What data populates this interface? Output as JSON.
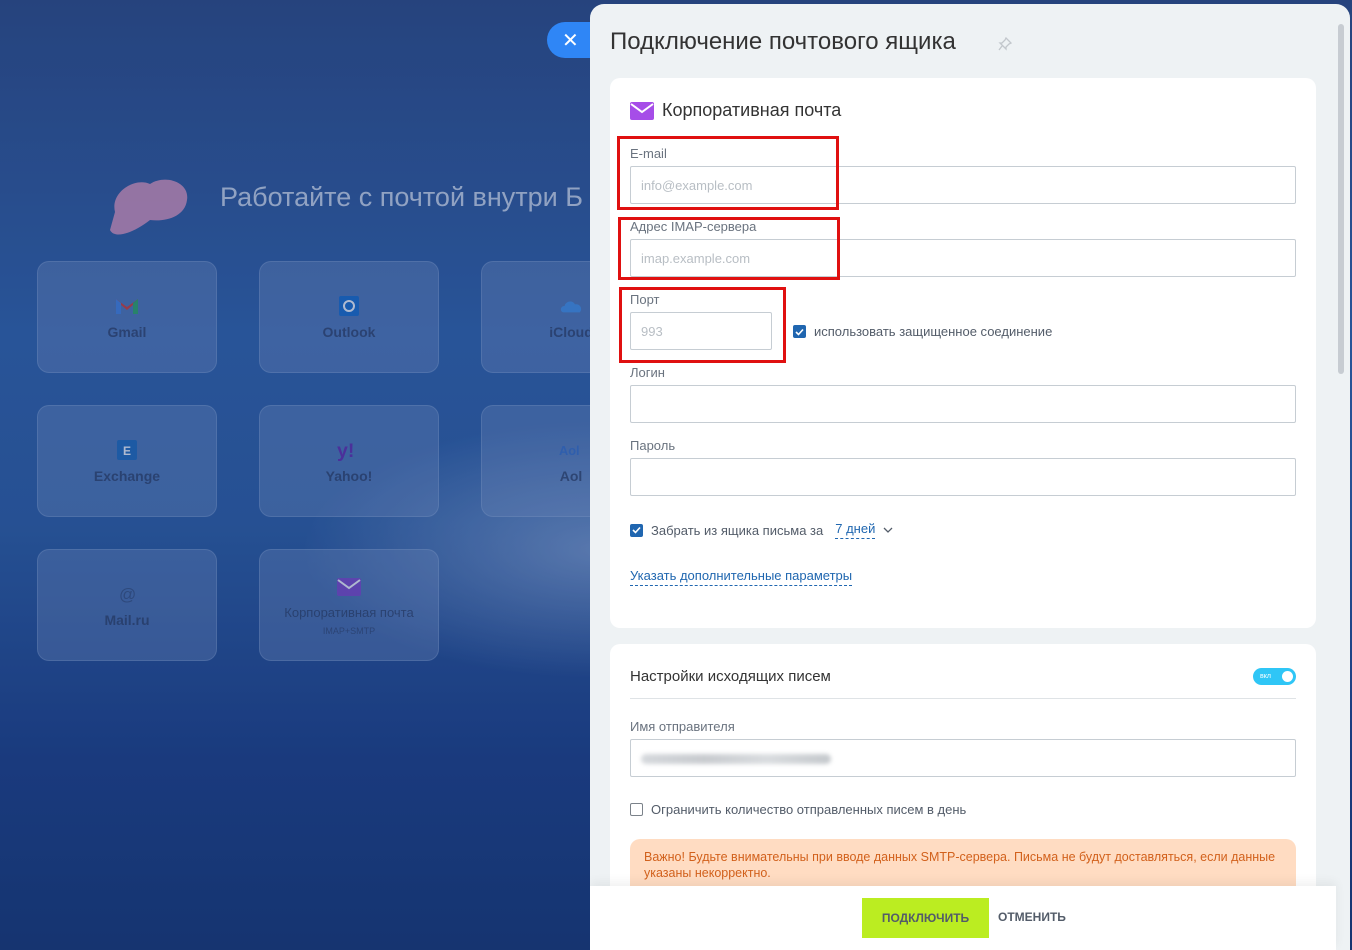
{
  "background": {
    "headline": "Работайте с почтой внутри Б",
    "tiles": [
      {
        "label": "Gmail",
        "icon": "gmail-icon"
      },
      {
        "label": "Outlook",
        "icon": "outlook-icon"
      },
      {
        "label": "iCloud",
        "icon": "icloud-icon"
      },
      {
        "label": "Exchange",
        "icon": "exchange-icon"
      },
      {
        "label": "Yahoo!",
        "icon": "yahoo-icon"
      },
      {
        "label": "Aol",
        "icon": "aol-icon"
      },
      {
        "label": "Mail.ru",
        "icon": "mailru-icon"
      },
      {
        "label": "Корпоративная почта",
        "sub": "IMAP+SMTP",
        "icon": "envelope-icon"
      }
    ],
    "close_glyph": "✕"
  },
  "panel": {
    "title": "Подключение почтового ящика",
    "card1": {
      "title": "Корпоративная почта",
      "email": {
        "label": "E-mail",
        "placeholder": "info@example.com",
        "value": ""
      },
      "imap": {
        "label": "Адрес IMAP-сервера",
        "placeholder": "imap.example.com",
        "value": ""
      },
      "port": {
        "label": "Порт",
        "placeholder": "993",
        "value": ""
      },
      "ssl_label": "использовать защищенное соединение",
      "login": {
        "label": "Логин",
        "value": ""
      },
      "password": {
        "label": "Пароль",
        "value": ""
      },
      "fetch_label": "Забрать из ящика письма за",
      "fetch_period": "7 дней",
      "advanced_link": "Указать дополнительные параметры"
    },
    "card2": {
      "title": "Настройки исходящих писем",
      "toggle_label": "вкл",
      "sender": {
        "label": "Имя отправителя"
      },
      "limit_label": "Ограничить количество отправленных писем в день",
      "warning": "Важно! Будьте внимательны при вводе данных SMTP-сервера. Письма не будут доставляться, если данные указаны некорректно."
    },
    "footer": {
      "connect": "ПОДКЛЮЧИТЬ",
      "cancel": "ОТМЕНИТЬ"
    }
  },
  "colors": {
    "accent": "#2067b0",
    "connect_button": "#bbed21",
    "toggle": "#2fc6f6",
    "highlight": "#e01010",
    "warning_bg": "#ffdcc2",
    "envelope": "#a64de8"
  }
}
